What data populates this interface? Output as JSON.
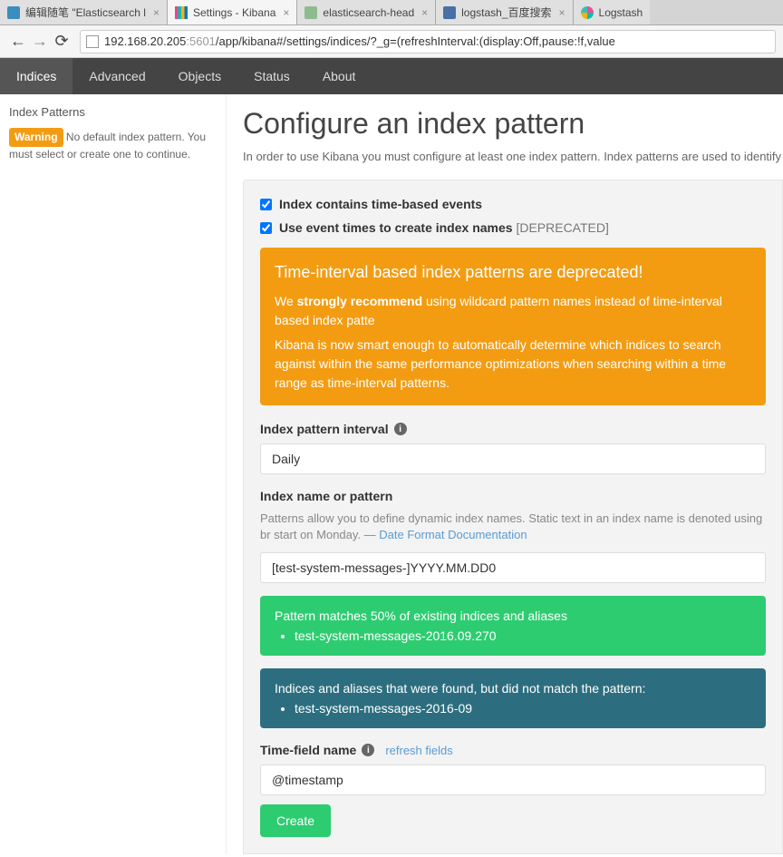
{
  "browser": {
    "tabs": [
      {
        "label": "编辑随笔 \"Elasticsearch l"
      },
      {
        "label": "Settings - Kibana"
      },
      {
        "label": "elasticsearch-head"
      },
      {
        "label": "logstash_百度搜索"
      },
      {
        "label": "Logstash"
      }
    ],
    "url_host": "192.168.20.205",
    "url_port": ":5601",
    "url_path": "/app/kibana#/settings/indices/?_g=(refreshInterval:(display:Off,pause:!f,value"
  },
  "nav": {
    "items": [
      "Indices",
      "Advanced",
      "Objects",
      "Status",
      "About"
    ]
  },
  "sidebar": {
    "title": "Index Patterns",
    "warning_label": "Warning",
    "warning_text": "No default index pattern. You must select or create one to continue."
  },
  "page": {
    "title": "Configure an index pattern",
    "intro": "In order to use Kibana you must configure at least one index pattern. Index patterns are used to identify"
  },
  "form": {
    "checkbox1_label": "Index contains time-based events",
    "checkbox2_label_bold": "Use event times to create index names",
    "checkbox2_label_depr": " [DEPRECATED]",
    "deprecated_alert": {
      "title": "Time-interval based index patterns are deprecated!",
      "p1a": "We ",
      "p1b": "strongly recommend",
      "p1c": " using wildcard pattern names instead of time-interval based index patte",
      "p2": "Kibana is now smart enough to automatically determine which indices to search against within the same performance optimizations when searching within a time range as time-interval patterns."
    },
    "interval_label": "Index pattern interval",
    "interval_value": "Daily",
    "name_label": "Index name or pattern",
    "name_helper_pre": "Patterns allow you to define dynamic index names. Static text in an index name is denoted using br start on Monday. — ",
    "name_helper_link": "Date Format Documentation",
    "name_value": "[test-system-messages-]YYYY.MM.DD0",
    "match_success_title": "Pattern matches 50% of existing indices and aliases",
    "match_success_item": "test-system-messages-2016.09.270",
    "match_fail_title": "Indices and aliases that were found, but did not match the pattern:",
    "match_fail_item": "test-system-messages-2016-09",
    "timefield_label": "Time-field name",
    "refresh_link": "refresh fields",
    "timefield_value": "@timestamp",
    "create_label": "Create"
  }
}
